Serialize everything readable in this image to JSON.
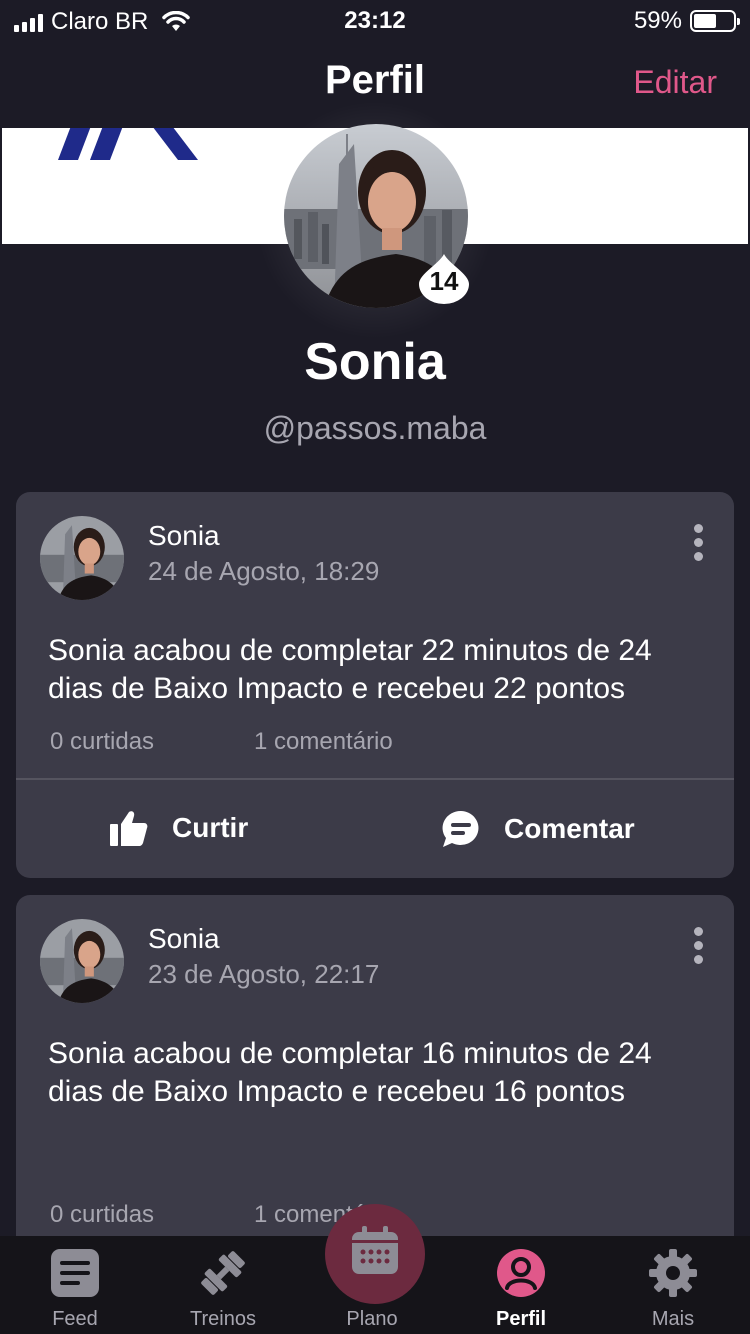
{
  "status_bar": {
    "carrier": "Claro BR",
    "time": "23:12",
    "battery": "59%",
    "battery_level": 0.59
  },
  "header": {
    "title": "Perfil",
    "edit_label": "Editar"
  },
  "profile": {
    "name": "Sonia",
    "handle": "@passos.maba",
    "level": "14"
  },
  "posts": [
    {
      "author": "Sonia",
      "date": "24 de Agosto, 18:29",
      "text": "Sonia acabou de completar 22 minutos de 24 dias de Baixo Impacto e recebeu 22 pontos",
      "likes": "0 curtidas",
      "comments": "1 comentário",
      "like_label": "Curtir",
      "comment_label": "Comentar"
    },
    {
      "author": "Sonia",
      "date": "23 de Agosto, 22:17",
      "text": "Sonia acabou de completar 16 minutos de 24 dias de Baixo Impacto e recebeu 16 pontos",
      "likes": "0 curtidas",
      "comments": "1 comentário"
    }
  ],
  "tabs": [
    {
      "label": "Feed",
      "icon": "feed-icon"
    },
    {
      "label": "Treinos",
      "icon": "dumbbell-icon"
    },
    {
      "label": "Plano",
      "icon": "calendar-icon"
    },
    {
      "label": "Perfil",
      "icon": "user-icon",
      "active": true
    },
    {
      "label": "Mais",
      "icon": "gear-icon"
    }
  ],
  "colors": {
    "background": "#1c1b26",
    "card": "#3c3b48",
    "accent": "#e0588a",
    "tab_bar": "#151419",
    "plan_button": "#6c2a3f"
  }
}
